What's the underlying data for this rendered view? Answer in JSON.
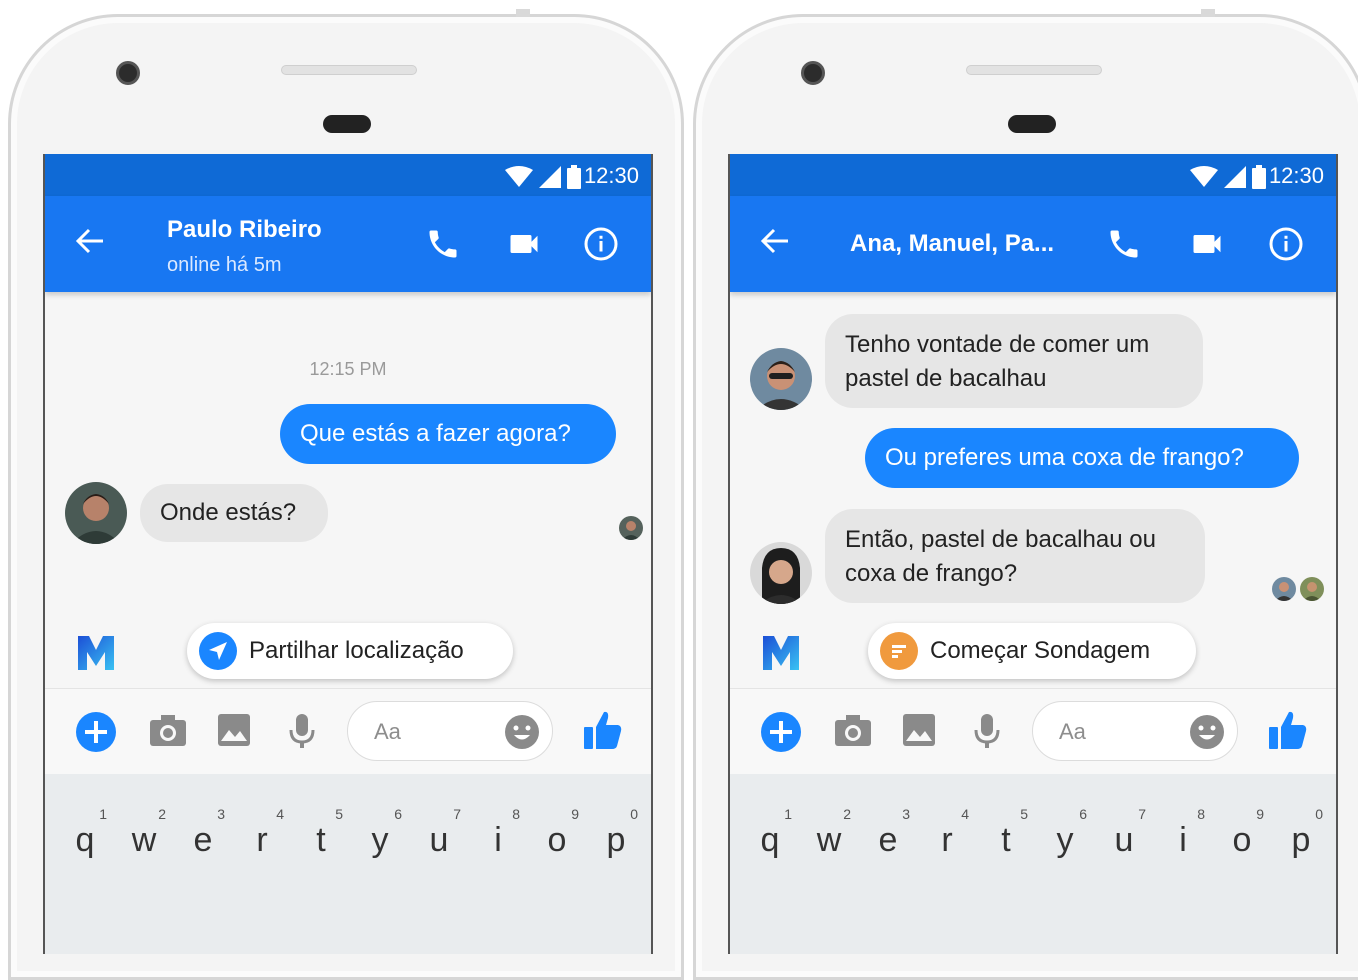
{
  "left_screen": {
    "status_time": "12:30",
    "contact_name": "Paulo Ribeiro",
    "contact_status": "online há 5m",
    "timestamp": "12:15 PM",
    "messages": [
      {
        "from": "me",
        "text": "Que estás a fazer agora?"
      },
      {
        "from": "them",
        "text": "Onde estás?"
      }
    ],
    "suggestion": "Partilhar localização",
    "input_placeholder": "Aa"
  },
  "right_screen": {
    "status_time": "12:30",
    "group_name": "Ana, Manuel, Pa...",
    "messages": [
      {
        "from": "them",
        "text": "Tenho vontade de comer um pastel de bacalhau"
      },
      {
        "from": "me",
        "text": "Ou preferes uma coxa de frango?"
      },
      {
        "from": "them",
        "text": "Então, pastel de bacalhau ou coxa de frango?"
      }
    ],
    "suggestion": "Começar Sondagem",
    "input_placeholder": "Aa"
  },
  "keyboard_row": [
    {
      "key": "q",
      "hint": "1"
    },
    {
      "key": "w",
      "hint": "2"
    },
    {
      "key": "e",
      "hint": "3"
    },
    {
      "key": "r",
      "hint": "4"
    },
    {
      "key": "t",
      "hint": "5"
    },
    {
      "key": "y",
      "hint": "6"
    },
    {
      "key": "u",
      "hint": "7"
    },
    {
      "key": "i",
      "hint": "8"
    },
    {
      "key": "o",
      "hint": "9"
    },
    {
      "key": "p",
      "hint": "0"
    }
  ],
  "colors": {
    "appbar": "#1877f2",
    "statusbar": "#0f6ad6",
    "outgoing_bubble": "#1a86ff",
    "incoming_bubble": "#e6e6e6",
    "poll_icon": "#f09a3e"
  }
}
